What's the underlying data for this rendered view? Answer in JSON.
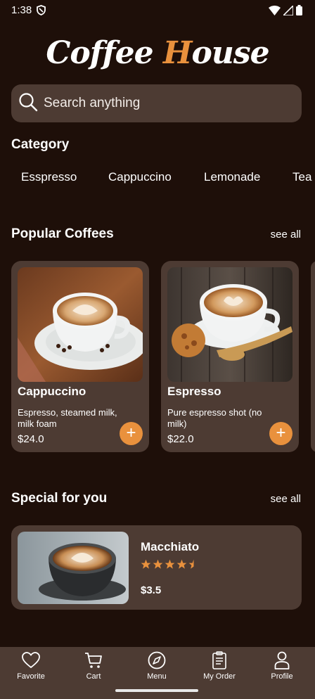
{
  "status_bar": {
    "time": "1:38"
  },
  "brand": {
    "word1": "Coffee",
    "word2_first": "H",
    "word2_rest": "ouse"
  },
  "search": {
    "placeholder": "Search anything"
  },
  "category": {
    "title": "Category",
    "items": [
      "Esspresso",
      "Cappuccino",
      "Lemonade",
      "Tea"
    ]
  },
  "popular": {
    "title": "Popular Coffees",
    "see_all": "see all",
    "items": [
      {
        "name": "Cappuccino",
        "description": "Espresso, steamed milk, milk foam",
        "price": "$24.0"
      },
      {
        "name": "Espresso",
        "description": "Pure espresso shot (no milk)",
        "price": "$22.0"
      }
    ]
  },
  "special": {
    "title": "Special for you",
    "see_all": "see all",
    "item": {
      "name": "Macchiato",
      "rating": 4.5,
      "rating_max": 5,
      "price": "$3.5"
    }
  },
  "bottom_nav": {
    "items": [
      {
        "label": "Favorite",
        "icon": "heart-icon"
      },
      {
        "label": "Cart",
        "icon": "cart-icon"
      },
      {
        "label": "Menu",
        "icon": "compass-icon"
      },
      {
        "label": "My Order",
        "icon": "receipt-icon"
      },
      {
        "label": "Profile",
        "icon": "person-icon"
      }
    ]
  },
  "colors": {
    "background": "#1e0f09",
    "surface": "#4d3b33",
    "accent": "#e9913d"
  }
}
